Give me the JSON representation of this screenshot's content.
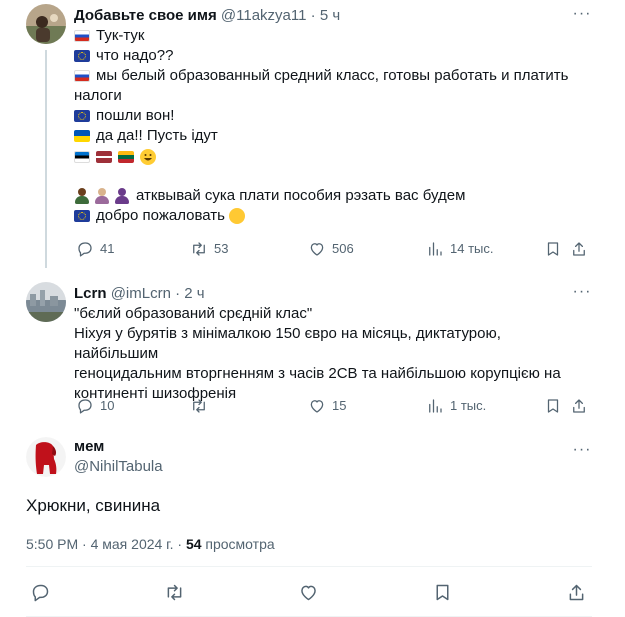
{
  "tweets": [
    {
      "name": "Добавьте свое имя",
      "handle": "@11akzya11",
      "dot": "·",
      "time": "5 ч",
      "lines": [
        "Тук-тук",
        "что надо??",
        "мы белый образованный средний класс, готовы работать и платить",
        "налоги",
        "пошли вон!",
        "да да!! Пусть ідут",
        "атквывай сука плати пособия рэзать вас будем",
        "добро пожаловать"
      ],
      "flags": [
        "russia",
        "eu",
        "russia",
        "eu",
        "ukraine",
        "estonia",
        "latvia",
        "lithuania",
        "eu"
      ],
      "emojis": [
        "grinning-face",
        "person-dark",
        "person-light",
        "person-hijab",
        "hugging-face"
      ],
      "replies": "41",
      "retweets": "53",
      "likes": "506",
      "views": "14 тыс."
    },
    {
      "name": "Lcrn",
      "handle": "@imLcrn",
      "dot": "·",
      "time": "2 ч",
      "lines": [
        "\"бєлий образований срєдній клас\"",
        "Ніхуя у бурятів з мінімалкою 150 євро на місяць, диктатурою, найбільшим",
        "геноцидальним вторгненням з часів 2СВ та найбільшою корупцією на",
        "континенті шизофренія"
      ],
      "replies": "10",
      "retweets": "",
      "likes": "15",
      "views": "1 тыс."
    }
  ],
  "main_tweet": {
    "name": "мем",
    "handle": "@NihilTabula",
    "text": "Хрюкни, свинина",
    "time": "5:50 PM",
    "dot": "·",
    "date": "4 мая 2024 г.",
    "dot2": "·",
    "views_count": "54",
    "views_label": "просмотра"
  },
  "icons": [
    "reply-icon",
    "retweet-icon",
    "like-icon",
    "views-icon",
    "share-icon",
    "bookmark-icon",
    "more-icon"
  ],
  "colors": {
    "text": "#0f1419",
    "secondary": "#536471",
    "divider": "#eff3f4",
    "thread_line": "#cfd9de"
  }
}
